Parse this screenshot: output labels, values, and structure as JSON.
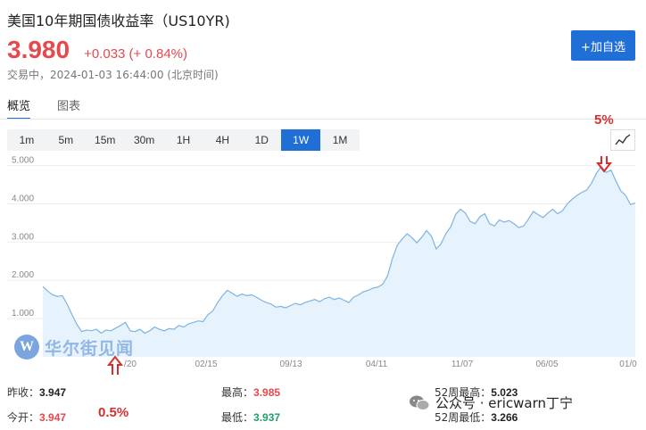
{
  "header": {
    "title": "美国10年期国债收益率（US10YR)",
    "price": "3.980",
    "change": "+0.033 (+ 0.84%)",
    "status": "交易中，2024-01-03 16:44:00 (北京时间)",
    "add_button": "+加自选"
  },
  "tabs": [
    {
      "label": "概览",
      "active": true
    },
    {
      "label": "图表",
      "active": false
    }
  ],
  "periods": [
    {
      "label": "1m"
    },
    {
      "label": "5m"
    },
    {
      "label": "15m"
    },
    {
      "label": "30m"
    },
    {
      "label": "1H"
    },
    {
      "label": "4H"
    },
    {
      "label": "1D"
    },
    {
      "label": "1W",
      "active": true
    },
    {
      "label": "1M"
    }
  ],
  "chart_data": {
    "type": "area",
    "ylim": [
      0,
      5.2
    ],
    "y_ticks": [
      "5.000",
      "4.000",
      "3.000",
      "2.000",
      "1.000"
    ],
    "y_tick_values": [
      5,
      4,
      3,
      2,
      1
    ],
    "x_ticks": [
      "/20",
      "02/15",
      "09/13",
      "04/11",
      "11/07",
      "06/05",
      "01/0"
    ],
    "grid": true,
    "color": "#7fb3e0",
    "fill": "#e6f2fc",
    "series": [
      {
        "values": [
          1.84,
          1.72,
          1.62,
          1.58,
          1.6,
          1.38,
          1.1,
          0.85,
          0.66,
          0.7,
          0.68,
          0.72,
          0.62,
          0.7,
          0.68,
          0.75,
          0.82,
          0.9,
          0.68,
          0.66,
          0.72,
          0.62,
          0.68,
          0.78,
          0.72,
          0.68,
          0.74,
          0.72,
          0.82,
          0.78,
          0.86,
          0.9,
          0.94,
          0.92,
          1.1,
          1.2,
          1.42,
          1.6,
          1.74,
          1.66,
          1.58,
          1.64,
          1.6,
          1.62,
          1.56,
          1.48,
          1.42,
          1.38,
          1.3,
          1.32,
          1.28,
          1.34,
          1.4,
          1.36,
          1.42,
          1.46,
          1.5,
          1.44,
          1.52,
          1.56,
          1.5,
          1.54,
          1.48,
          1.42,
          1.56,
          1.62,
          1.7,
          1.74,
          1.8,
          1.82,
          1.9,
          2.12,
          2.58,
          2.92,
          3.08,
          3.22,
          3.12,
          2.98,
          3.12,
          3.3,
          3.16,
          2.82,
          2.96,
          3.22,
          3.4,
          3.72,
          3.86,
          3.76,
          3.54,
          3.48,
          3.66,
          3.74,
          3.48,
          3.42,
          3.58,
          3.52,
          3.56,
          3.48,
          3.38,
          3.42,
          3.6,
          3.8,
          3.72,
          3.64,
          3.76,
          3.86,
          3.74,
          3.82,
          4.0,
          4.12,
          4.22,
          4.3,
          4.36,
          4.54,
          4.8,
          4.98,
          4.82,
          4.88,
          4.6,
          4.34,
          4.22,
          3.98,
          4.02
        ]
      }
    ]
  },
  "annotations": [
    {
      "label": "5%"
    },
    {
      "label": "0.5%"
    }
  ],
  "stats": {
    "prev_close_label": "昨收：",
    "prev_close": "3.947",
    "open_label": "今开：",
    "open": "3.947",
    "high_label": "最高：",
    "high": "3.985",
    "low_label": "最低：",
    "low": "3.937",
    "w52_high_label": "52周最高：",
    "w52_high": "5.023",
    "w52_low_label": "52周最低：",
    "w52_low": "3.266"
  },
  "watermark": {
    "logo_letter": "W",
    "logo_text": "华尔街见闻",
    "wechat_text": "公众号 · ericwarn丁宁"
  }
}
